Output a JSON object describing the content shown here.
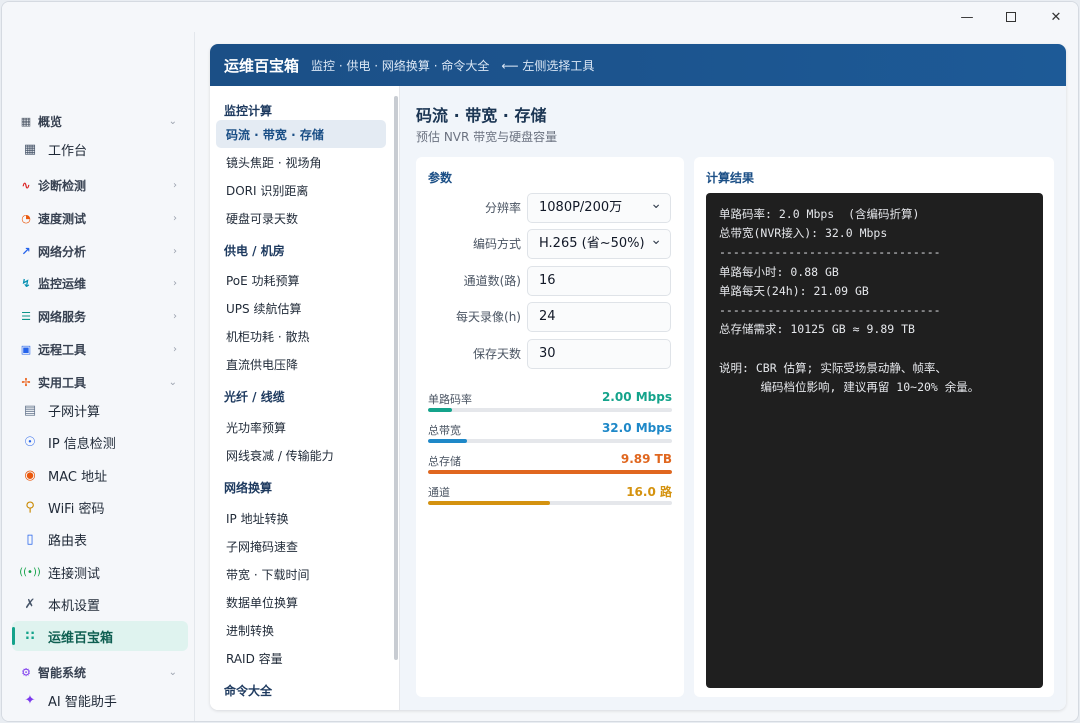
{
  "window": {
    "minimize_icon": "minimize-icon",
    "maximize_icon": "maximize-icon",
    "close_icon": "close-icon"
  },
  "sidebar": {
    "groups": [
      {
        "label": "概览",
        "icon": "grid-icon",
        "chevron": "⌄"
      },
      {
        "label": "诊断检测",
        "icon": "pulse-icon",
        "chevron": "›"
      },
      {
        "label": "速度测试",
        "icon": "speedometer-icon",
        "chevron": "›"
      },
      {
        "label": "网络分析",
        "icon": "chart-line-icon",
        "chevron": "›"
      },
      {
        "label": "监控运维",
        "icon": "bolt-icon",
        "chevron": "›"
      },
      {
        "label": "网络服务",
        "icon": "database-icon",
        "chevron": "›"
      },
      {
        "label": "远程工具",
        "icon": "terminal-icon",
        "chevron": "›"
      },
      {
        "label": "实用工具",
        "icon": "tools-icon",
        "chevron": "⌄"
      },
      {
        "label": "智能系统",
        "icon": "cpu-icon",
        "chevron": "⌄"
      }
    ],
    "items": [
      {
        "label": "工作台",
        "icon": "dashboard-icon"
      },
      {
        "label": "子网计算",
        "icon": "calculator-icon"
      },
      {
        "label": "IP 信息检测",
        "icon": "globe-icon"
      },
      {
        "label": "MAC 地址",
        "icon": "fingerprint-icon"
      },
      {
        "label": "WiFi 密码",
        "icon": "key-icon"
      },
      {
        "label": "路由表",
        "icon": "map-icon"
      },
      {
        "label": "连接测试",
        "icon": "signal-icon"
      },
      {
        "label": "本机设置",
        "icon": "wrench-icon"
      },
      {
        "label": "运维百宝箱",
        "icon": "apps-grid-icon"
      },
      {
        "label": "AI 智能助手",
        "icon": "sparkle-icon"
      }
    ]
  },
  "banner": {
    "title": "运维百宝箱",
    "subtitle": "监控 · 供电 · 网络换算 · 命令大全",
    "hint": "⟵ 左侧选择工具"
  },
  "tools": {
    "categories": [
      "监控计算",
      "供电 / 机房",
      "光纤 / 线缆",
      "网络换算",
      "命令大全"
    ],
    "items": [
      "码流 · 带宽 · 存储",
      "镜头焦距 · 视场角",
      "DORI 识别距离",
      "硬盘可录天数",
      "PoE 功耗预算",
      "UPS 续航估算",
      "机柜功耗 · 散热",
      "直流供电压降",
      "光功率预算",
      "网线衰减 / 传输能力",
      "IP 地址转换",
      "子网掩码速查",
      "带宽 · 下载时间",
      "数据单位换算",
      "进制转换",
      "RAID 容量"
    ]
  },
  "content": {
    "title": "码流 · 带宽 · 存储",
    "subtitle": "预估 NVR 带宽与硬盘容量",
    "params_header": "参数",
    "fields": [
      {
        "label": "分辨率",
        "value": "1080P/200万"
      },
      {
        "label": "编码方式",
        "value": "H.265 (省~50%)"
      },
      {
        "label": "通道数(路)",
        "value": "16"
      },
      {
        "label": "每天录像(h)",
        "value": "24"
      },
      {
        "label": "保存天数",
        "value": "30"
      }
    ],
    "meters": [
      {
        "label": "单路码率",
        "value": "2.00 Mbps",
        "color": "#14a38b",
        "fill": 0.1
      },
      {
        "label": "总带宽",
        "value": "32.0 Mbps",
        "color": "#1e88c8",
        "fill": 0.16
      },
      {
        "label": "总存储",
        "value": "9.89 TB",
        "color": "#e0671f",
        "fill": 1.0
      },
      {
        "label": "通道",
        "value": "16.0 路",
        "color": "#d4920f",
        "fill": 0.5
      }
    ],
    "result_header": "计算结果",
    "result_lines": [
      "单路码率: 2.0 Mbps  (含编码折算)",
      "总带宽(NVR接入): 32.0 Mbps",
      "--------------------------------",
      "单路每小时: 0.88 GB",
      "单路每天(24h): 21.09 GB",
      "--------------------------------",
      "总存储需求: 10125 GB ≈ 9.89 TB",
      "",
      "说明: CBR 估算; 实际受场景动静、帧率、",
      "      编码档位影响, 建议再留 10~20% 余量。"
    ]
  }
}
